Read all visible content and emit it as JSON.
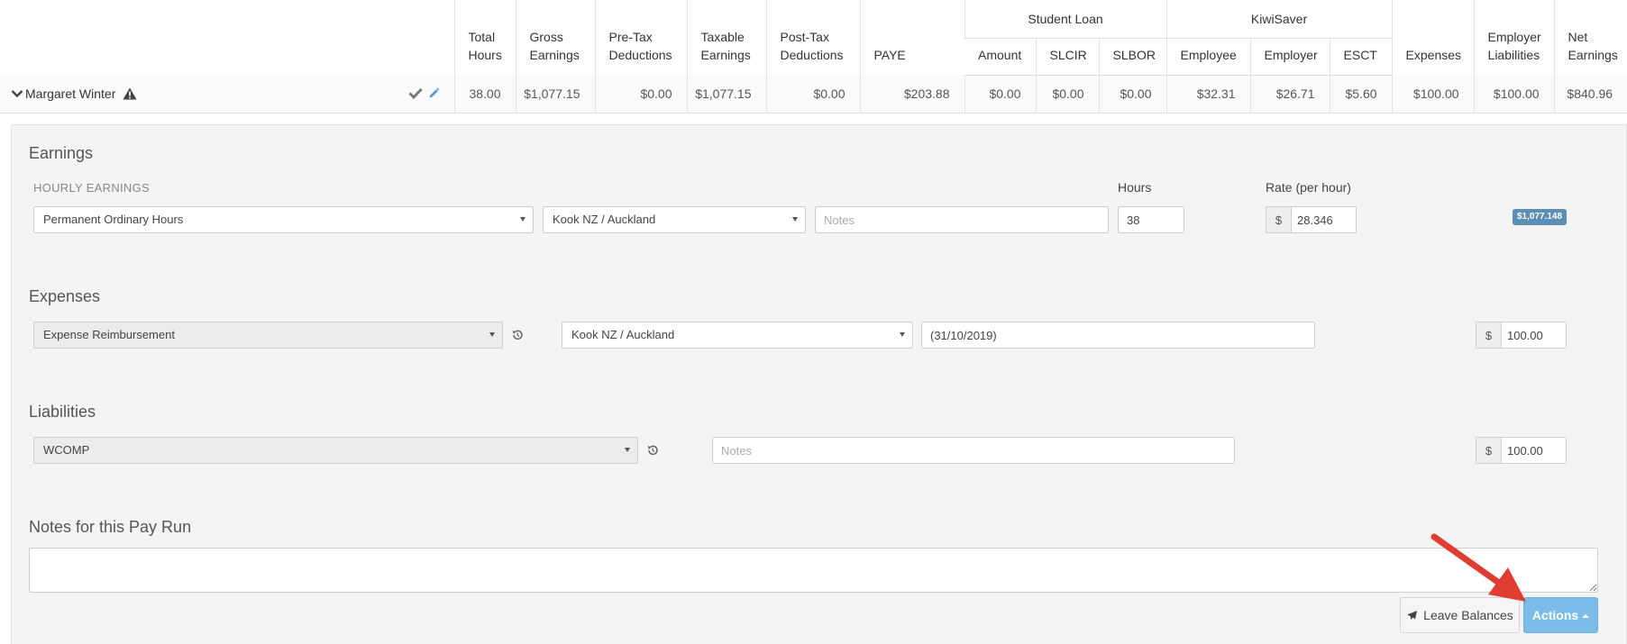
{
  "summary": {
    "headers": {
      "total_hours": "Total\nHours",
      "gross_earnings": "Gross\nEarnings",
      "pre_tax_deductions": "Pre-Tax\nDeductions",
      "taxable_earnings": "Taxable\nEarnings",
      "post_tax_deductions": "Post-Tax\nDeductions",
      "paye": "PAYE",
      "student_loan_group": "Student Loan",
      "sl_amount": "Amount",
      "sl_slcir": "SLCIR",
      "sl_slbor": "SLBOR",
      "kiwisaver_group": "KiwiSaver",
      "ks_employee": "Employee",
      "ks_employer": "Employer",
      "ks_esct": "ESCT",
      "expenses": "Expenses",
      "employer_liabilities": "Employer\nLiabilities",
      "net_earnings": "Net\nEarnings"
    },
    "row": {
      "employee_name": "Margaret Winter",
      "total_hours": "38.00",
      "gross_earnings": "$1,077.15",
      "pre_tax_deductions": "$0.00",
      "taxable_earnings": "$1,077.15",
      "post_tax_deductions": "$0.00",
      "paye": "$203.88",
      "sl_amount": "$0.00",
      "sl_slcir": "$0.00",
      "sl_slbor": "$0.00",
      "ks_employee": "$32.31",
      "ks_employer": "$26.71",
      "ks_esct": "$5.60",
      "expenses": "$100.00",
      "employer_liabilities": "$100.00",
      "net_earnings": "$840.96"
    }
  },
  "earnings": {
    "title": "Earnings",
    "subheading": "HOURLY EARNINGS",
    "hours_label": "Hours",
    "rate_label": "Rate (per hour)",
    "pay_category": "Permanent Ordinary Hours",
    "location": "Kook NZ / Auckland",
    "notes_placeholder": "Notes",
    "hours_value": "38",
    "currency_symbol": "$",
    "rate_value": "28.346",
    "total_badge": "$1,077.148"
  },
  "expenses": {
    "title": "Expenses",
    "category": "Expense Reimbursement",
    "location": "Kook NZ / Auckland",
    "notes_value": "(31/10/2019)",
    "currency_symbol": "$",
    "amount": "100.00"
  },
  "liabilities": {
    "title": "Liabilities",
    "category": "WCOMP",
    "notes_placeholder": "Notes",
    "currency_symbol": "$",
    "amount": "100.00"
  },
  "pay_run_notes": {
    "title": "Notes for this Pay Run"
  },
  "buttons": {
    "leave_balances": "Leave Balances",
    "actions": "Actions"
  },
  "colors": {
    "actions_button": "#7cbce8",
    "badge": "#5b8fb3",
    "annotation_arrow": "#e03c31"
  }
}
